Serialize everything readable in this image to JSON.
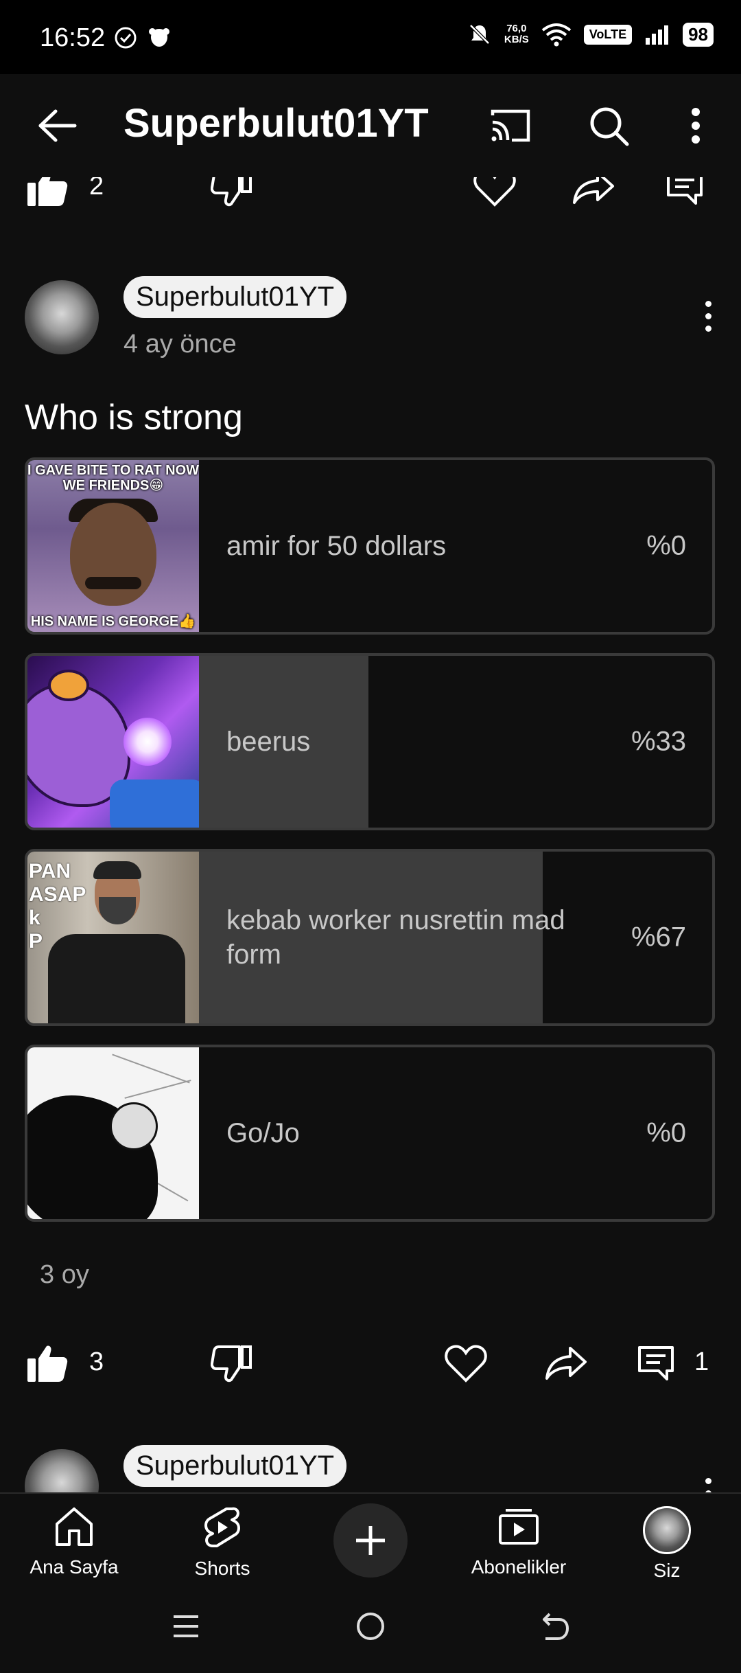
{
  "status_bar": {
    "time": "16:52",
    "net_speed_value": "76,0",
    "net_speed_unit": "KB/S",
    "volte": "VoLTE",
    "battery": "98"
  },
  "app_bar": {
    "title": "Superbulut01YT"
  },
  "prev_post_actions": {
    "like_count": "2"
  },
  "post": {
    "channel": "Superbulut01YT",
    "time_ago": "4 ay önce",
    "text": "Who is strong",
    "poll": [
      {
        "label": "amir for 50 dollars",
        "percent_text": "%0",
        "percent": 0,
        "thumb_top": "I GAVE BITE TO RAT NOW WE FRIENDS😁",
        "thumb_bottom": "HIS NAME IS GEORGE👍"
      },
      {
        "label": "beerus",
        "percent_text": "%33",
        "percent": 33
      },
      {
        "label": "kebab worker nusrettin mad form",
        "percent_text": "%67",
        "percent": 67,
        "thumb_text": "PAN\nASAP\nk\nP"
      },
      {
        "label": "Go/Jo",
        "percent_text": "%0",
        "percent": 0
      }
    ],
    "votes": "3 oy",
    "like_count": "3",
    "comment_count": "1"
  },
  "next_post": {
    "channel": "Superbulut01YT"
  },
  "bottom_nav": {
    "home": "Ana Sayfa",
    "shorts": "Shorts",
    "subscriptions": "Abonelikler",
    "you": "Siz"
  },
  "colors": {
    "background": "#0f0f0f",
    "poll_fill": "#3d3d3d",
    "poll_border": "#3a3a3a",
    "chip_bg": "#f1f1f1"
  }
}
